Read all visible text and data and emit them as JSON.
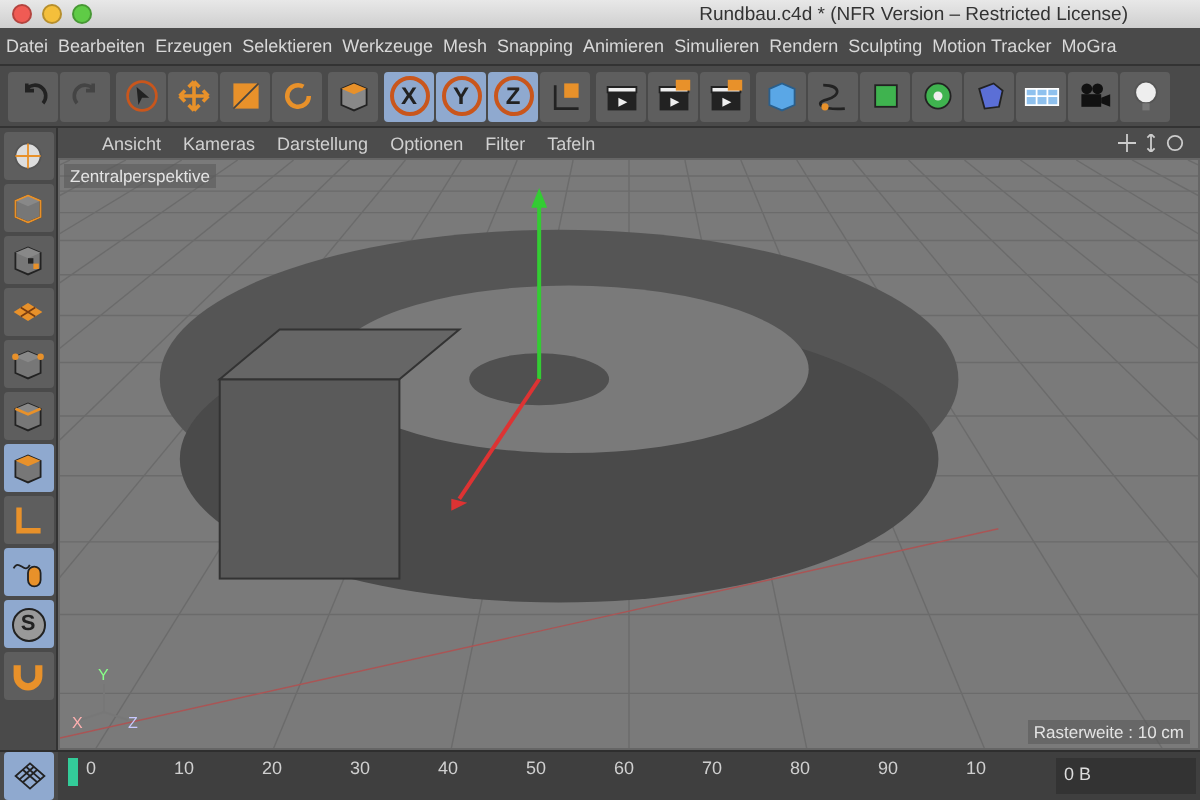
{
  "window": {
    "title": "Rundbau.c4d * (NFR Version – Restricted License)"
  },
  "menu": [
    "Datei",
    "Bearbeiten",
    "Erzeugen",
    "Selektieren",
    "Werkzeuge",
    "Mesh",
    "Snapping",
    "Animieren",
    "Simulieren",
    "Rendern",
    "Sculpting",
    "Motion Tracker",
    "MoGra"
  ],
  "toolbar": [
    {
      "kind": "undo",
      "selected": false
    },
    {
      "kind": "redo",
      "selected": false
    },
    {
      "kind": "select",
      "selected": false
    },
    {
      "kind": "move",
      "selected": false
    },
    {
      "kind": "scale",
      "selected": false
    },
    {
      "kind": "rotate",
      "selected": false
    },
    {
      "kind": "object",
      "selected": false
    },
    {
      "kind": "axis",
      "label": "X",
      "selected": true
    },
    {
      "kind": "axis",
      "label": "Y",
      "selected": true
    },
    {
      "kind": "axis",
      "label": "Z",
      "selected": true
    },
    {
      "kind": "coords",
      "selected": false
    },
    {
      "kind": "render-view",
      "selected": false
    },
    {
      "kind": "render",
      "selected": false
    },
    {
      "kind": "render-settings",
      "selected": false
    },
    {
      "kind": "cube",
      "selected": false
    },
    {
      "kind": "spline",
      "selected": false
    },
    {
      "kind": "nurbs",
      "selected": false
    },
    {
      "kind": "array",
      "selected": false
    },
    {
      "kind": "deformer",
      "selected": false
    },
    {
      "kind": "floor",
      "selected": false
    },
    {
      "kind": "camera",
      "selected": false
    },
    {
      "kind": "light",
      "selected": false
    }
  ],
  "palette": [
    {
      "kind": "globe",
      "selected": false
    },
    {
      "kind": "cube-outline",
      "selected": false
    },
    {
      "kind": "checker",
      "selected": false
    },
    {
      "kind": "plane",
      "selected": false
    },
    {
      "kind": "points",
      "selected": false
    },
    {
      "kind": "edges",
      "selected": false
    },
    {
      "kind": "polygons",
      "selected": true
    },
    {
      "kind": "axis",
      "selected": false
    },
    {
      "kind": "mouse",
      "selected": true
    },
    {
      "kind": "snap",
      "label": "S",
      "selected": true
    },
    {
      "kind": "magnet",
      "selected": false
    },
    {
      "kind": "grid",
      "selected": true
    }
  ],
  "viewport": {
    "menu": [
      "Ansicht",
      "Kameras",
      "Darstellung",
      "Optionen",
      "Filter",
      "Tafeln"
    ],
    "camera": "Zentralperspektive",
    "grid_info": "Rasterweite : 10 cm",
    "axis_labels": [
      "Y",
      "X",
      "Z"
    ]
  },
  "timeline": {
    "ticks": [
      "0",
      "10",
      "20",
      "30",
      "40",
      "50",
      "60",
      "70",
      "80",
      "90",
      "10"
    ],
    "frame": "0 B"
  }
}
